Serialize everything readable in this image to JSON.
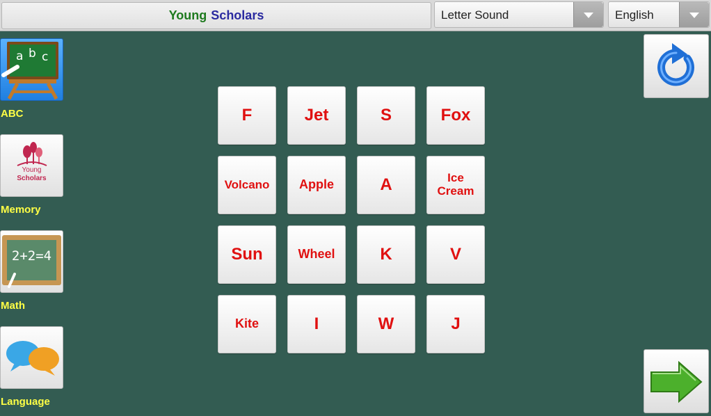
{
  "header": {
    "title_part1": "Young",
    "title_part2": "Scholars",
    "mode_select": {
      "value": "Letter Sound"
    },
    "language_select": {
      "value": "English"
    }
  },
  "sidebar": {
    "items": [
      {
        "label": "ABC",
        "icon": "chalkboard-abc-icon",
        "active": true
      },
      {
        "label": "Memory",
        "icon": "young-scholars-logo",
        "logo_text": [
          "Young",
          "Scholars"
        ]
      },
      {
        "label": "Math",
        "icon": "math-slate-icon",
        "slate_text": "2+2=4"
      },
      {
        "label": "Language",
        "icon": "speech-bubbles-icon"
      }
    ]
  },
  "grid": {
    "tiles": [
      "F",
      "Jet",
      "S",
      "Fox",
      "Volcano",
      "Apple",
      "A",
      "Ice Cream",
      "Sun",
      "Wheel",
      "K",
      "V",
      "Kite",
      "I",
      "W",
      "J"
    ]
  },
  "controls": {
    "refresh_icon": "refresh-icon",
    "next_icon": "next-arrow-icon"
  },
  "colors": {
    "background": "#335c52",
    "tile_text": "#e01010",
    "nav_label": "#ffff45",
    "title_green": "#1e7a1e",
    "title_blue": "#2a2aa0"
  }
}
